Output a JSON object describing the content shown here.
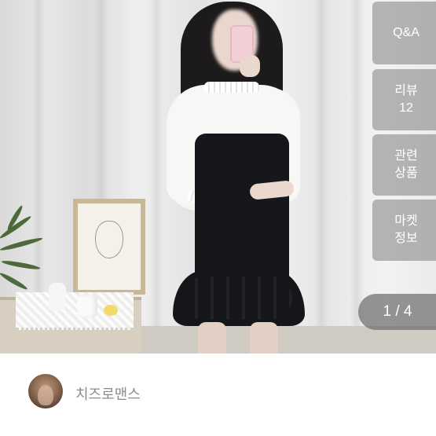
{
  "side_tabs": [
    {
      "lines": [
        "Q&A"
      ]
    },
    {
      "lines": [
        "리뷰",
        "12"
      ]
    },
    {
      "lines": [
        "관련",
        "상품"
      ]
    },
    {
      "lines": [
        "마켓",
        "정보"
      ]
    }
  ],
  "image_counter": "1 / 4",
  "seller": {
    "name": "치즈로맨스",
    "avatar_icon": "seller-avatar"
  },
  "colors": {
    "tab_overlay": "#808080",
    "seller_name": "#8a8a8a"
  }
}
